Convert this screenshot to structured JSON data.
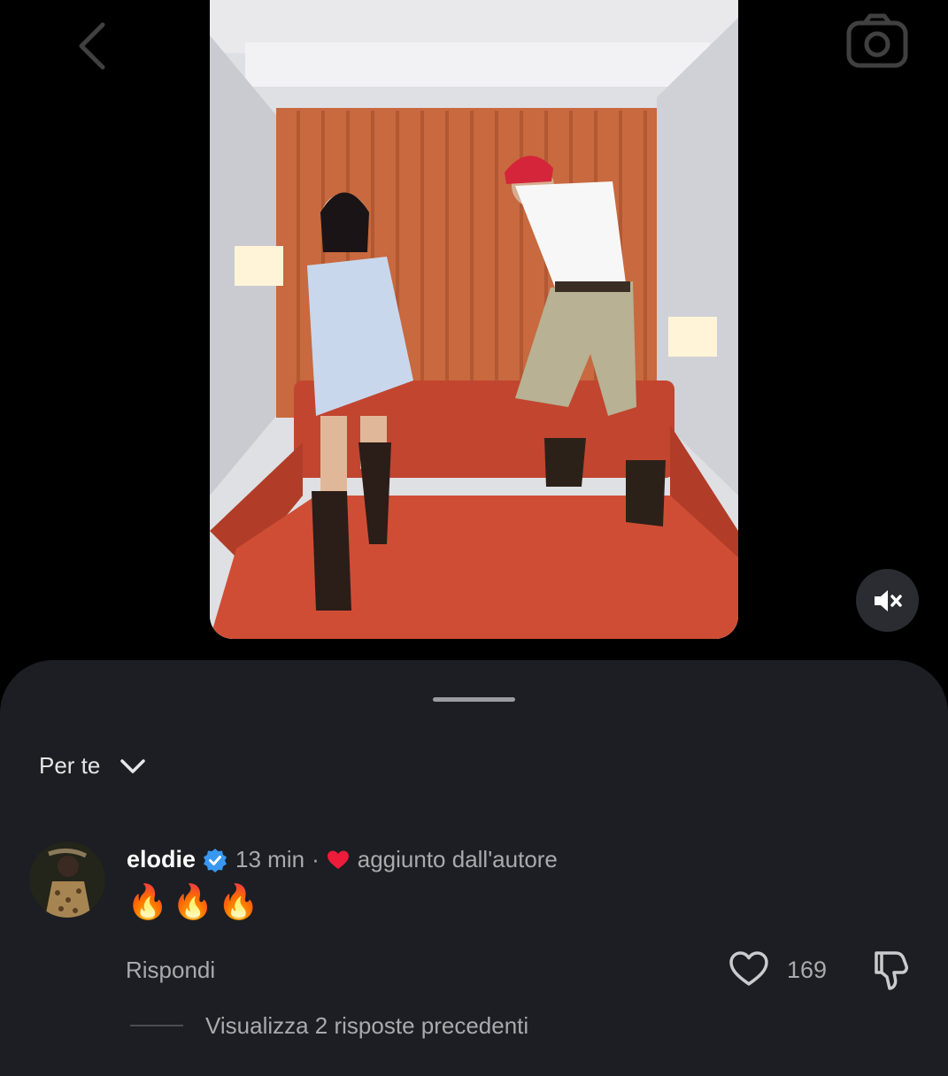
{
  "icons": {
    "back": "chevron-left-icon",
    "camera": "camera-icon",
    "mute": "speaker-muted-icon",
    "sort": "chevron-down-icon",
    "verified": "verified-badge-icon",
    "author_like": "heart-filled-icon",
    "like": "heart-outline-icon",
    "dislike": "thumbs-down-icon"
  },
  "colors": {
    "sheet_background": "#1c1e23",
    "verified_blue": "#3897f0",
    "heart_red": "#ed1c3a",
    "muted_text": "#a8aaae"
  },
  "comments": {
    "sort_label": "Per te",
    "items": [
      {
        "username": "elodie",
        "time": "13 min",
        "separator": "·",
        "author_badge": "aggiunto dall'autore",
        "text": "🔥🔥🔥",
        "reply_label": "Rispondi",
        "like_count": "169",
        "view_replies_label": "Visualizza 2 risposte precedenti"
      }
    ]
  }
}
